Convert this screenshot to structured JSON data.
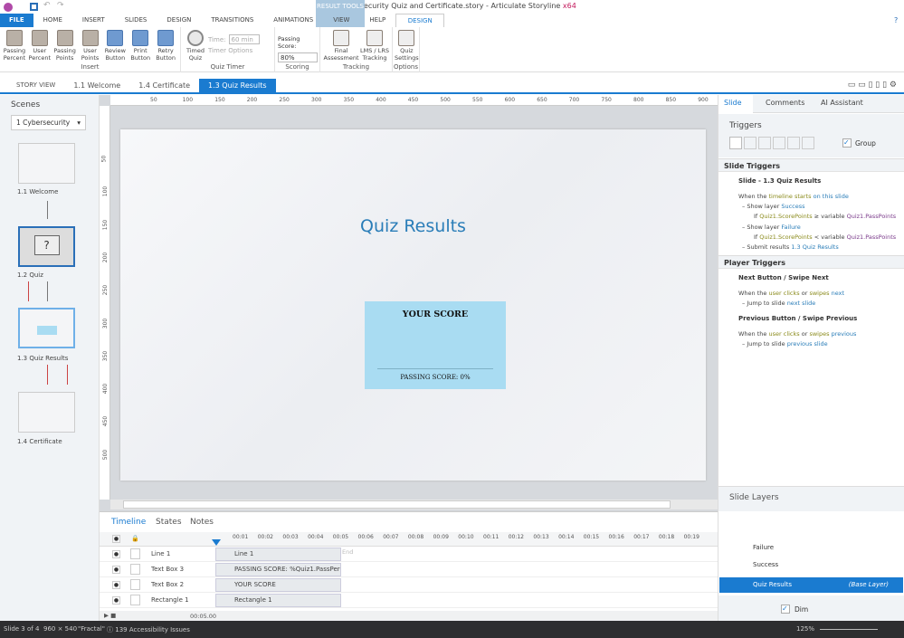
{
  "window": {
    "title": "FP Cybersecurity Quiz and Certificate.story - Articulate Storyline",
    "arch": "x64",
    "context_tab": "RESULT TOOLS"
  },
  "ribbon_tabs": [
    "FILE",
    "HOME",
    "INSERT",
    "SLIDES",
    "DESIGN",
    "TRANSITIONS",
    "ANIMATIONS",
    "VIEW",
    "HELP",
    "DESIGN"
  ],
  "ribbon": {
    "insert": {
      "label": "Insert",
      "buttons": [
        "Passing Percent",
        "User Percent",
        "Passing Points",
        "User Points",
        "Review Button",
        "Print Button",
        "Retry Button"
      ]
    },
    "timer": {
      "label": "Quiz Timer",
      "timed": "Timed Quiz",
      "time_label": "Time:",
      "time_value": "60 min",
      "options": "Timer Options"
    },
    "scoring": {
      "label": "Scoring",
      "passing_label": "Passing Score:",
      "passing_value": "80%"
    },
    "tracking": {
      "label": "Tracking",
      "buttons": [
        "Final Assessment",
        "LMS / LRS Tracking"
      ]
    },
    "options": {
      "label": "Options",
      "buttons": [
        "Quiz Settings"
      ]
    }
  },
  "doc_tabs": [
    "STORY VIEW",
    "1.1 Welcome",
    "1.4 Certificate",
    "1.3 Quiz Results"
  ],
  "scenes": {
    "title": "Scenes",
    "selected": "1 Cybersecurity",
    "slides": [
      "1.1 Welcome",
      "1.2 Quiz",
      "1.3 Quiz Results",
      "1.4 Certificate"
    ]
  },
  "ruler": {
    "h": [
      "50",
      "100",
      "150",
      "200",
      "250",
      "300",
      "350",
      "400",
      "450",
      "500",
      "550",
      "600",
      "650",
      "700",
      "750",
      "800",
      "850",
      "900"
    ],
    "v": [
      "50",
      "100",
      "150",
      "200",
      "250",
      "300",
      "350",
      "400",
      "450",
      "500"
    ]
  },
  "slide": {
    "title": "Quiz Results",
    "score_label": "YOUR SCORE",
    "passing_label": "PASSING SCORE: 0%"
  },
  "timeline": {
    "tabs": [
      "Timeline",
      "States",
      "Notes"
    ],
    "ticks": [
      "00:01",
      "00:02",
      "00:03",
      "00:04",
      "00:05",
      "00:06",
      "00:07",
      "00:08",
      "00:09",
      "00:10",
      "00:11",
      "00:12",
      "00:13",
      "00:14",
      "00:15",
      "00:16",
      "00:17",
      "00:18",
      "00:19"
    ],
    "end_label": "End",
    "duration": "00:05.00",
    "rows": [
      {
        "name": "Line 1",
        "bar": "Line 1"
      },
      {
        "name": "Text Box 3",
        "bar": "PASSING SCORE: %Quiz1.PassPerc..."
      },
      {
        "name": "Text Box 2",
        "bar": "YOUR SCORE"
      },
      {
        "name": "Rectangle 1",
        "bar": "Rectangle 1"
      }
    ]
  },
  "right_panel": {
    "tabs": [
      "Slide",
      "Comments",
      "AI Assistant"
    ],
    "triggers_title": "Triggers",
    "group_label": "Group",
    "slide_triggers": "Slide Triggers",
    "slide_name": "Slide - 1.3 Quiz Results",
    "when": [
      "When the",
      "timeline",
      "starts",
      "on",
      "this slide"
    ],
    "t1": [
      "Show layer",
      "Success"
    ],
    "c1": [
      "If",
      "Quiz1.ScorePoints",
      "≥ variable",
      "Quiz1.PassPoints"
    ],
    "t2": [
      "Show layer",
      "Failure"
    ],
    "c2": [
      "If",
      "Quiz1.ScorePoints",
      "< variable",
      "Quiz1.PassPoints"
    ],
    "t3": [
      "Submit results",
      "1.3 Quiz Results"
    ],
    "player_triggers": "Player Triggers",
    "next": {
      "title": "Next Button / Swipe Next",
      "when": [
        "When the",
        "user",
        "clicks",
        "or",
        "swipes",
        "next"
      ],
      "action": [
        "Jump to slide",
        "next slide"
      ]
    },
    "prev": {
      "title": "Previous Button / Swipe Previous",
      "when": [
        "When the",
        "user",
        "clicks",
        "or",
        "swipes",
        "previous"
      ],
      "action": [
        "Jump to slide",
        "previous slide"
      ]
    },
    "layers_title": "Slide Layers",
    "layers": [
      "Failure",
      "Success",
      "Quiz Results"
    ],
    "base_layer": "(Base Layer)",
    "dim_label": "Dim"
  },
  "status": {
    "slide": "Slide 3 of 4",
    "size": "960 × 540",
    "theme": "\"Fractal\"",
    "issues": "139 Accessibility Issues",
    "zoom": "125%"
  },
  "colors": {
    "accent": "#1a7bd0",
    "score_box": "#a9dcf2"
  }
}
